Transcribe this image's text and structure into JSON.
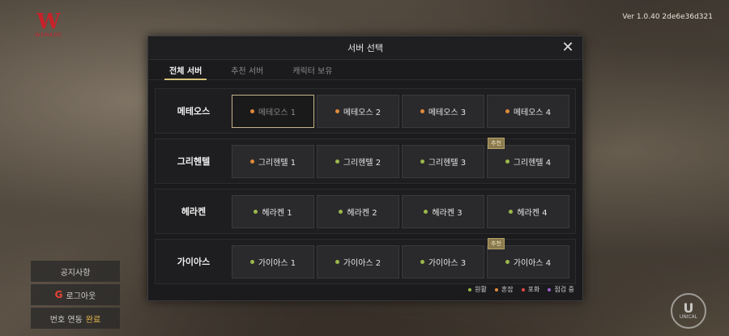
{
  "colors": {
    "smooth": "#9bb84a",
    "busy": "#e08a3a",
    "full": "#e04848",
    "maintenance": "#a060d0",
    "accent": "#d7c27a"
  },
  "logo": {
    "letter": "W",
    "text": "WEMADE"
  },
  "version": "Ver 1.0.40 2de6e36d321",
  "left_menu": {
    "notice": "공지사항",
    "logout": "로그아웃",
    "link_label": "번호 연동",
    "link_status": "완료"
  },
  "unical": {
    "letter": "U",
    "text": "UNICAL"
  },
  "modal": {
    "title": "서버 선택",
    "close": "✕",
    "tabs": [
      "전체 서버",
      "추천 서버",
      "캐릭터 보유"
    ],
    "groups": [
      {
        "name": "메테오스",
        "servers": [
          {
            "label": "메테오스 1",
            "status": "busy",
            "selected": true
          },
          {
            "label": "메테오스 2",
            "status": "busy"
          },
          {
            "label": "메테오스 3",
            "status": "busy"
          },
          {
            "label": "메테오스 4",
            "status": "busy"
          }
        ]
      },
      {
        "name": "그리헨텔",
        "servers": [
          {
            "label": "그리헨텔 1",
            "status": "busy"
          },
          {
            "label": "그리헨텔 2",
            "status": "smooth"
          },
          {
            "label": "그리헨텔 3",
            "status": "smooth"
          },
          {
            "label": "그리헨텔 4",
            "status": "smooth",
            "badge": "추천"
          }
        ]
      },
      {
        "name": "헤라켄",
        "servers": [
          {
            "label": "헤라켄 1",
            "status": "smooth"
          },
          {
            "label": "헤라켄 2",
            "status": "smooth"
          },
          {
            "label": "헤라켄 3",
            "status": "smooth"
          },
          {
            "label": "헤라켄 4",
            "status": "smooth"
          }
        ]
      },
      {
        "name": "가이아스",
        "servers": [
          {
            "label": "가이아스 1",
            "status": "smooth"
          },
          {
            "label": "가이아스 2",
            "status": "smooth"
          },
          {
            "label": "가이아스 3",
            "status": "smooth"
          },
          {
            "label": "가이아스 4",
            "status": "smooth",
            "badge": "추천"
          }
        ]
      }
    ],
    "legend": [
      {
        "label": "원활",
        "status": "smooth"
      },
      {
        "label": "혼잡",
        "status": "busy"
      },
      {
        "label": "포화",
        "status": "full"
      },
      {
        "label": "점검 중",
        "status": "maintenance"
      }
    ]
  }
}
